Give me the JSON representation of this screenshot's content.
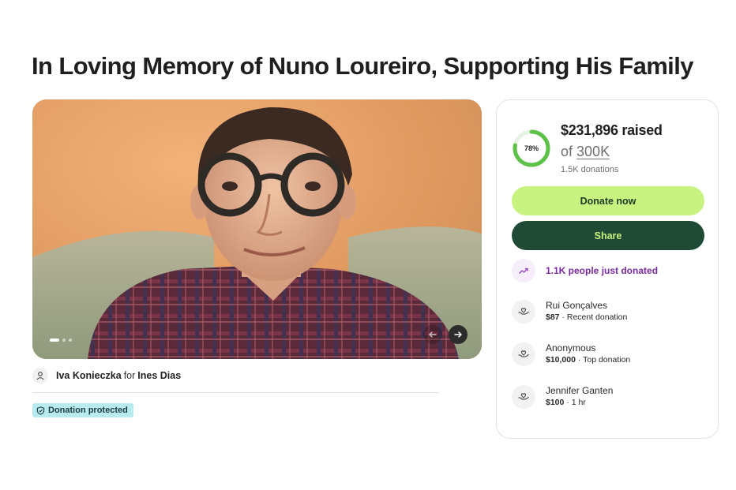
{
  "page": {
    "title": "In Loving Memory of Nuno Loureiro, Supporting His Family"
  },
  "gallery": {
    "slide_index": 1,
    "slide_count": 3
  },
  "organizer": {
    "name": "Iva Konieczka",
    "for_word": "for",
    "beneficiary": "Ines Dias"
  },
  "badge": {
    "label": "Donation protected"
  },
  "progress": {
    "percent_label": "78%",
    "percent": 78,
    "raised": "$231,896 raised",
    "of_word": "of",
    "goal": "300K",
    "donations": "1.5K donations",
    "ring_color": "#5ec24a"
  },
  "actions": {
    "donate_label": "Donate now",
    "share_label": "Share"
  },
  "trend": {
    "text": "1.1K people just donated"
  },
  "donors": [
    {
      "name": "Rui Gonçalves",
      "amount": "$87",
      "note": "Recent donation"
    },
    {
      "name": "Anonymous",
      "amount": "$10,000",
      "note": "Top donation"
    },
    {
      "name": "Jennifer Ganten",
      "amount": "$100",
      "note": "1 hr"
    }
  ],
  "icons": {
    "organizer": "person-icon",
    "badge": "shield-icon",
    "trend": "trend-up-icon",
    "donor": "heart-hands-icon",
    "prev": "arrow-left-icon",
    "next": "arrow-right-icon"
  },
  "colors": {
    "donate_bg": "#c8f380",
    "share_bg": "#1f4a35",
    "trend_text": "#7a2aa0",
    "badge_bg": "#b8ebef"
  }
}
